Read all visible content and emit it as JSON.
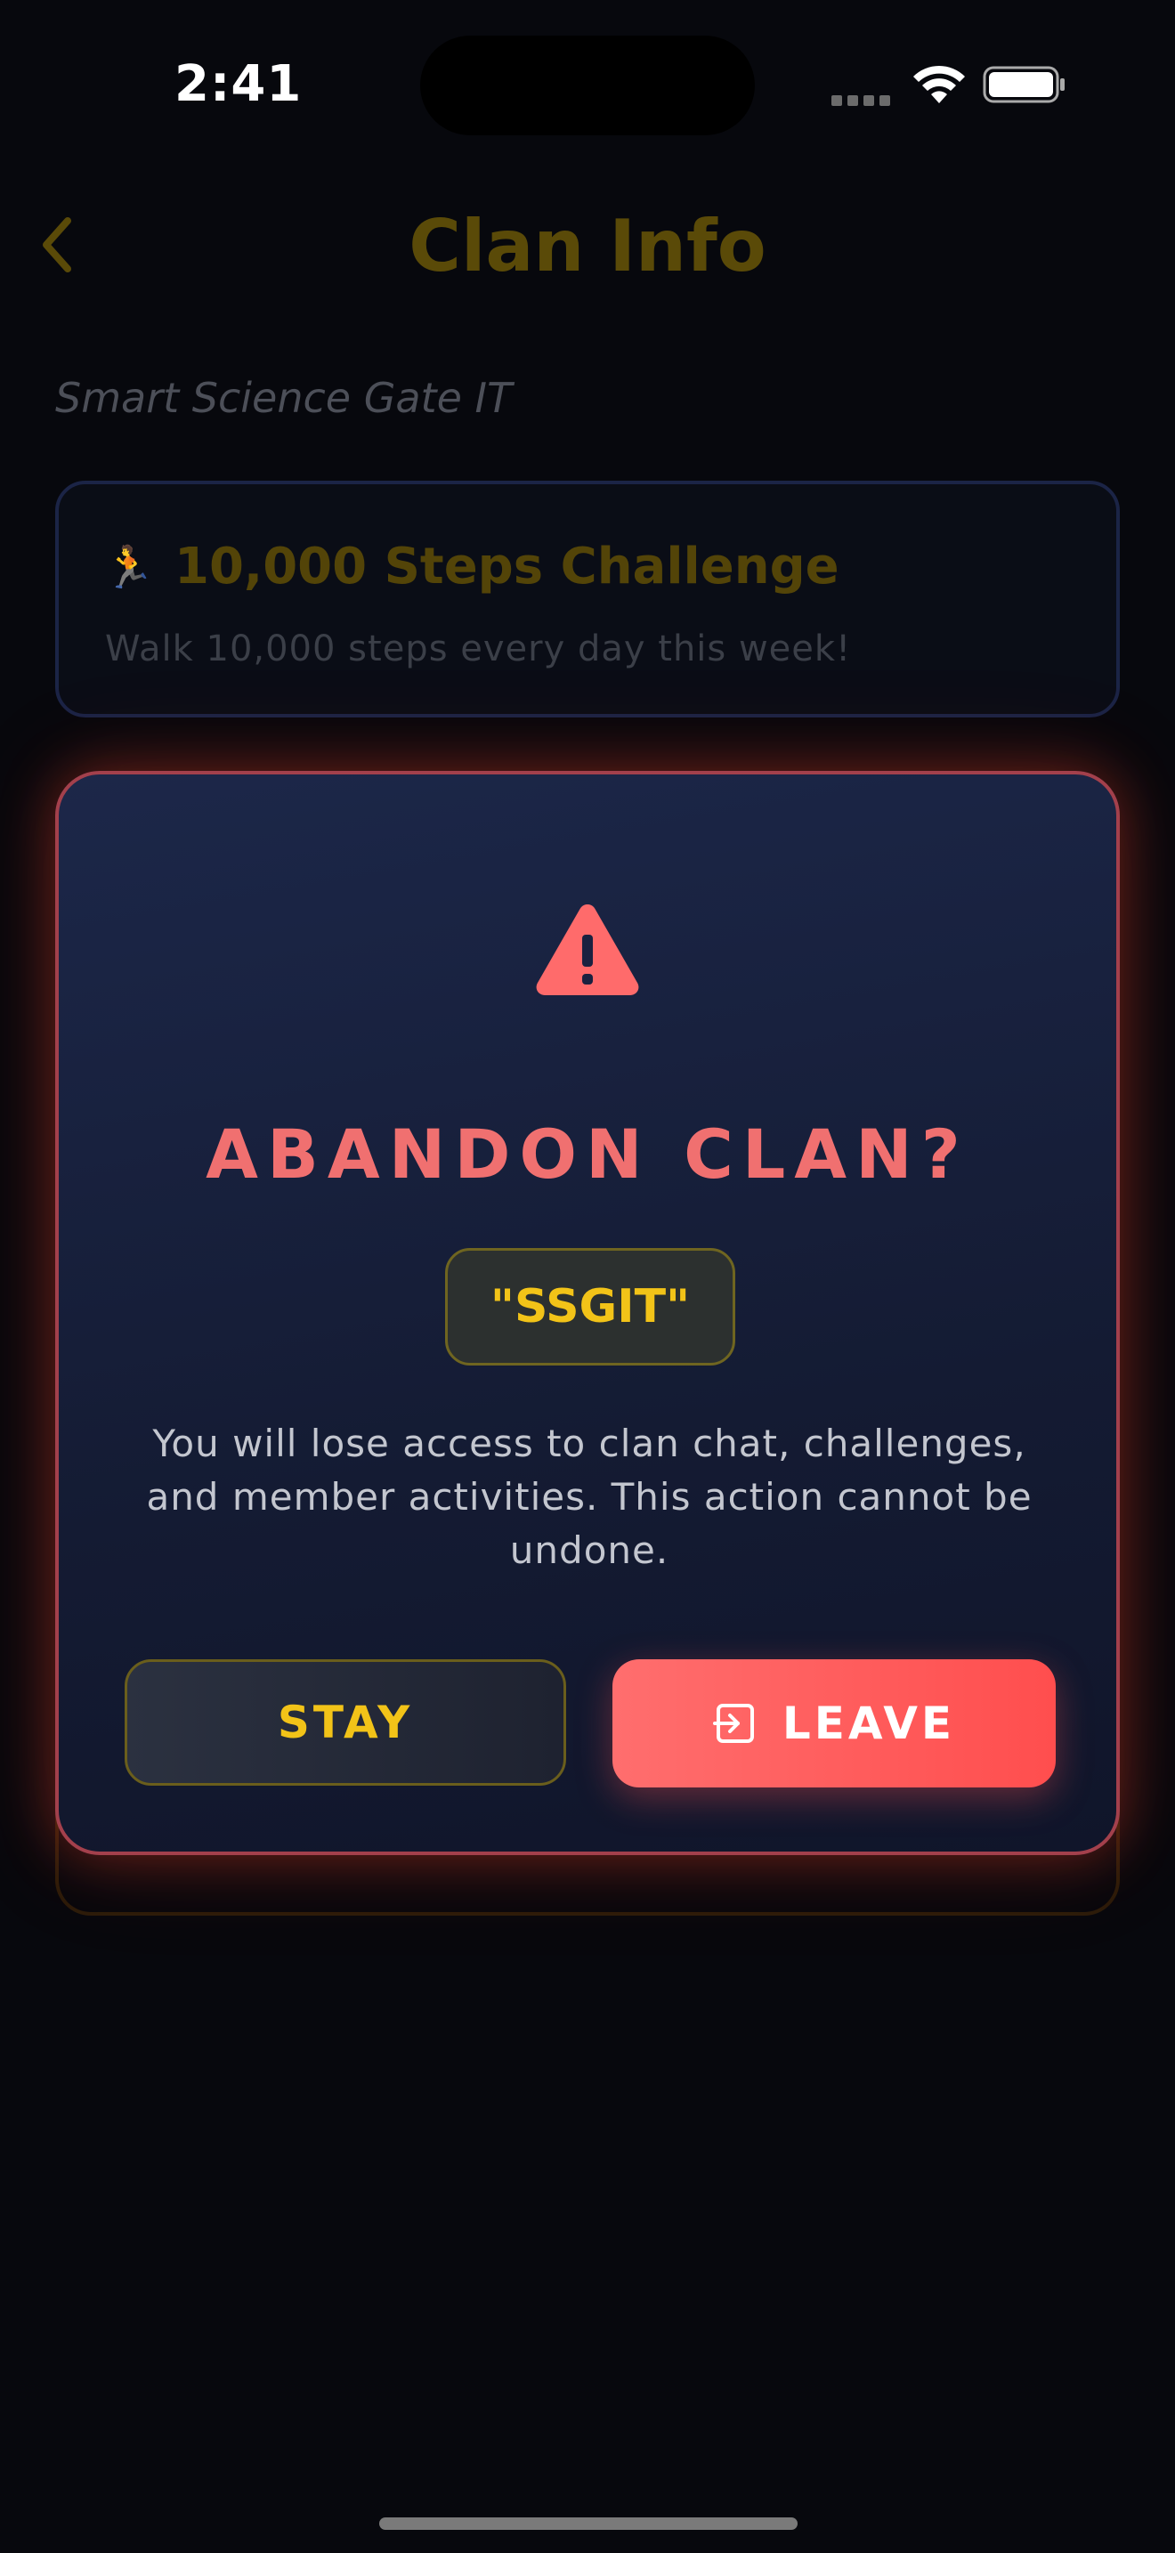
{
  "status_bar": {
    "time": "2:41"
  },
  "header": {
    "title": "Clan Info",
    "back_icon": "chevron-left-icon"
  },
  "clan": {
    "full_name": "Smart Science Gate IT"
  },
  "challenge": {
    "icon": "runner-icon",
    "icon_glyph": "🏃",
    "title": "10,000 Steps Challenge",
    "description": "Walk 10,000 steps every day this week!"
  },
  "modal": {
    "icon": "warning-triangle-icon",
    "title": "ABANDON CLAN?",
    "clan_tag": "\"SSGIT\"",
    "message": "You will lose access to clan chat, challenges, and member activities. This action cannot be undone.",
    "stay_label": "STAY",
    "leave_label": "LEAVE",
    "leave_icon": "exit-icon"
  },
  "colors": {
    "accent_gold": "#f2c318",
    "danger_red": "#ff5a5a",
    "modal_border": "#a3404c"
  }
}
